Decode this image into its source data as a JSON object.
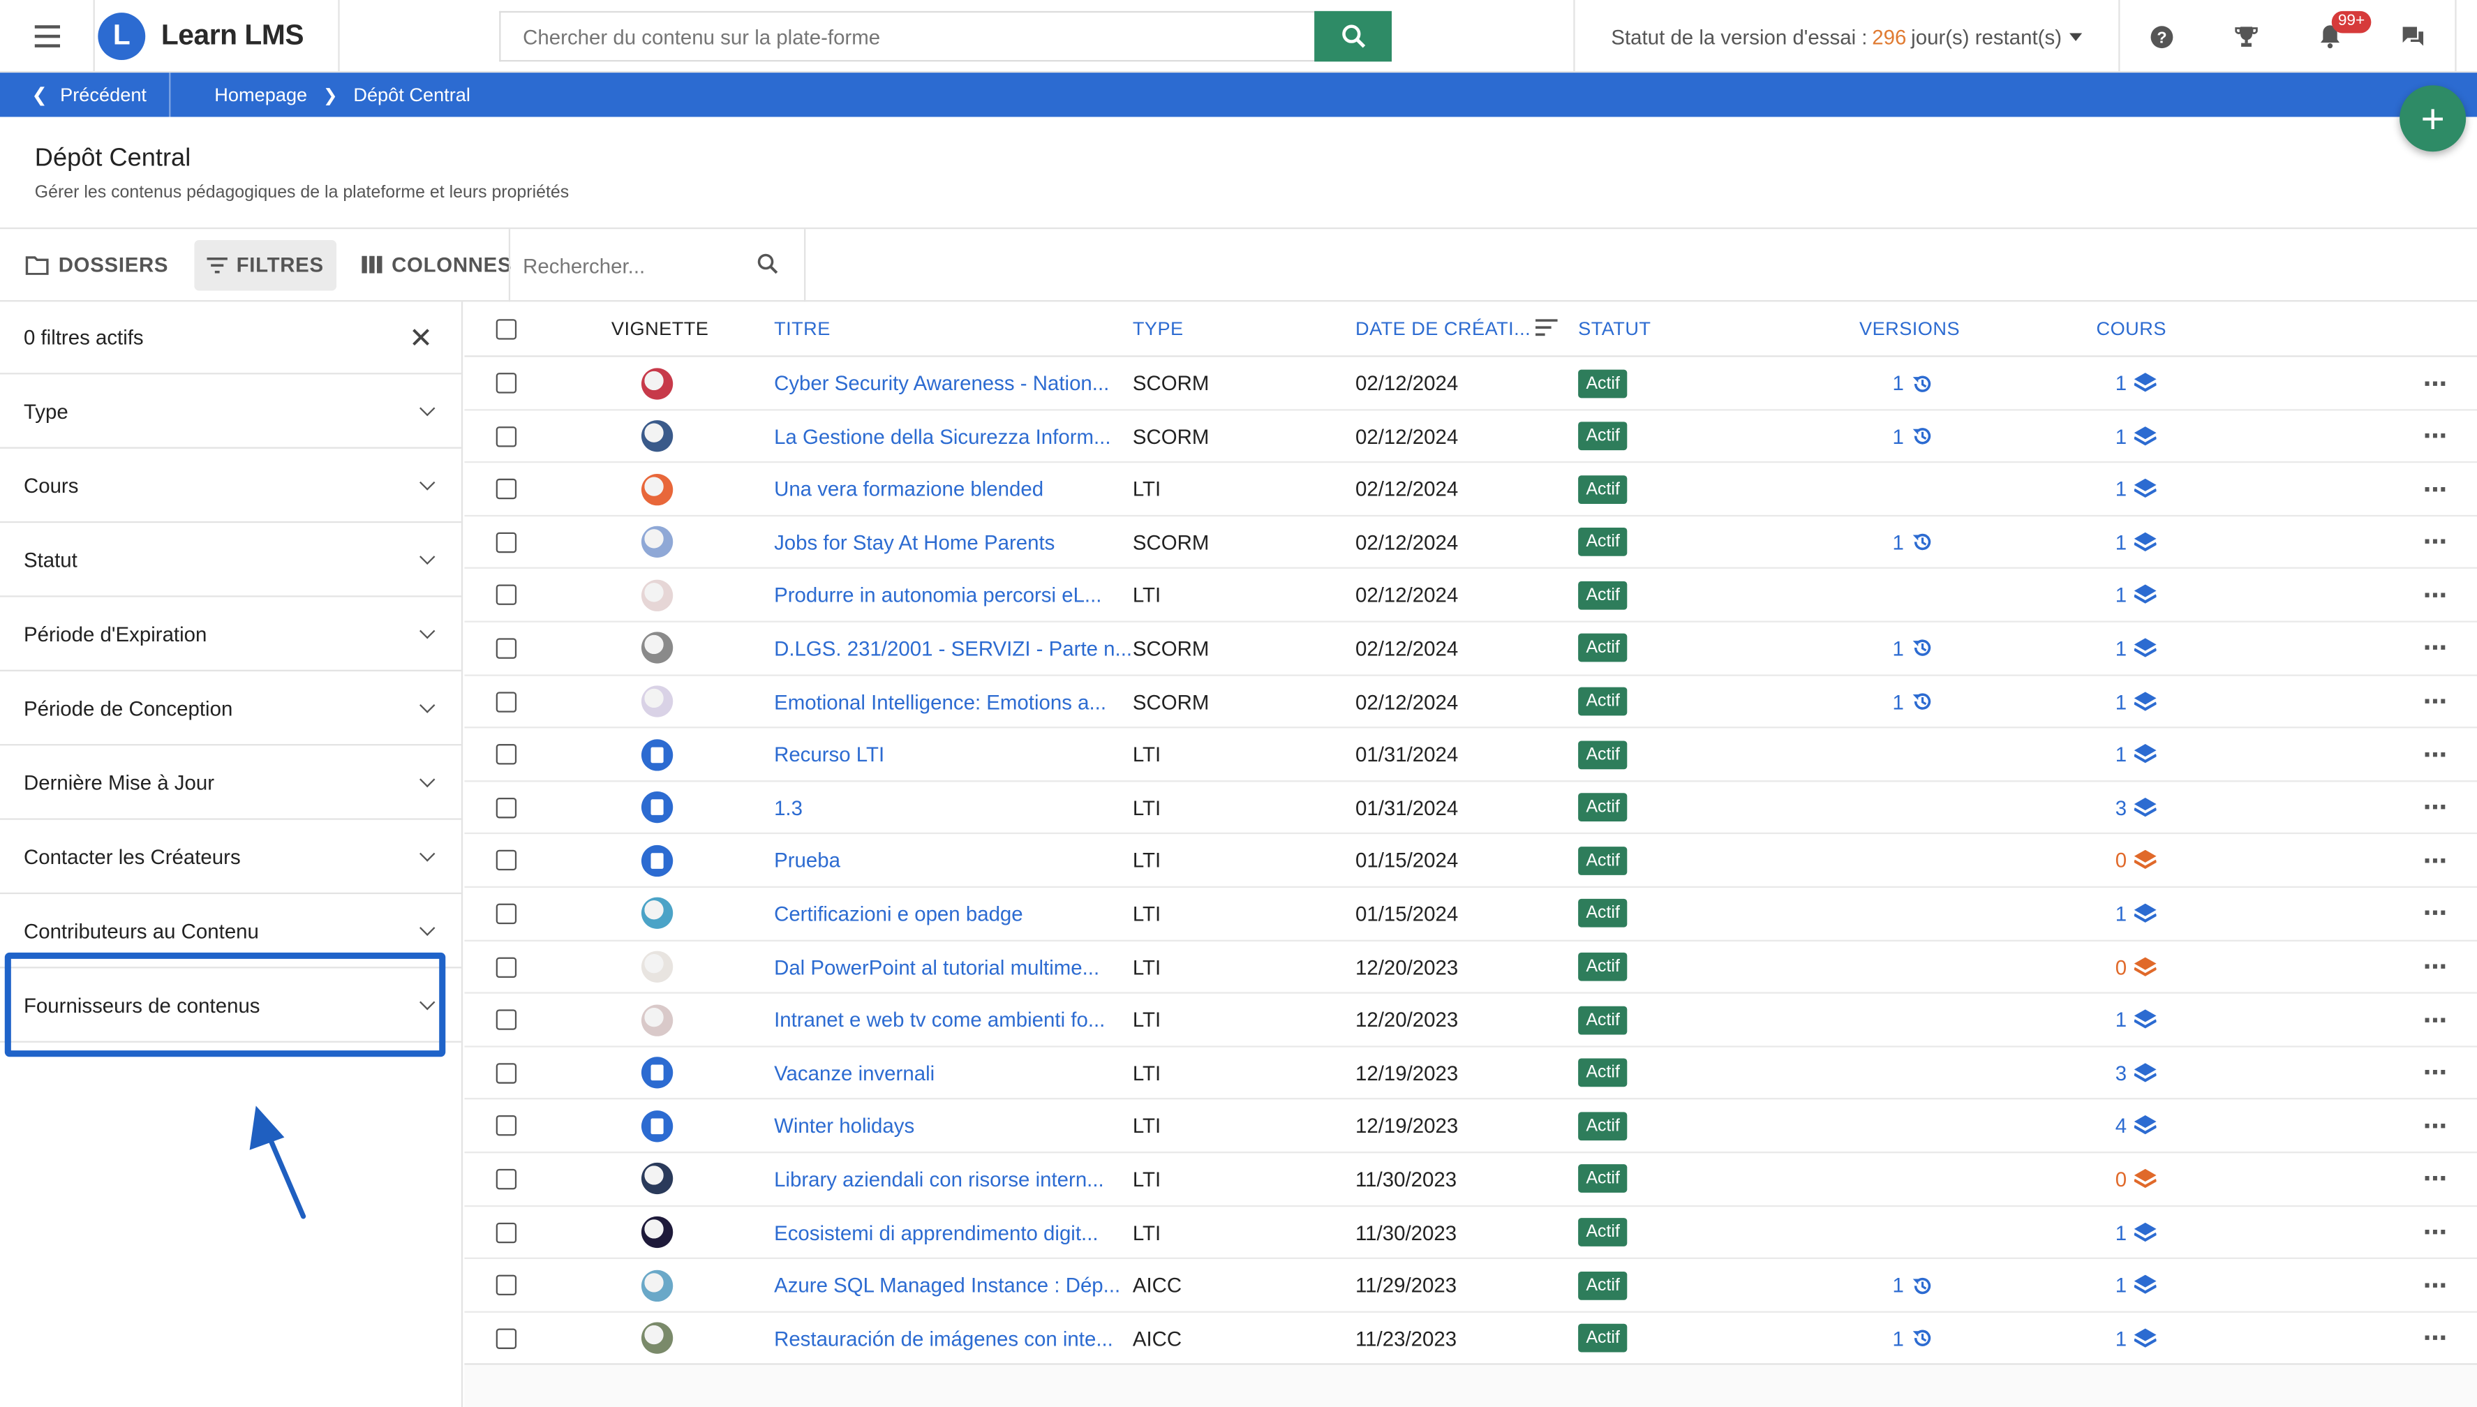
{
  "app": {
    "name": "Learn LMS",
    "logo_letter": "L"
  },
  "search": {
    "placeholder": "Chercher du contenu sur la plate-forme"
  },
  "trial": {
    "prefix": "Statut de la version d'essai :",
    "days": "296",
    "suffix": "jour(s) restant(s)"
  },
  "notifications": {
    "badge": "99+"
  },
  "breadcrumb": {
    "back": "Précédent",
    "items": [
      "Homepage",
      "Dépôt Central"
    ]
  },
  "fab": {
    "label": "+"
  },
  "page": {
    "title": "Dépôt Central",
    "subtitle": "Gérer les contenus pédagogiques de la plateforme et leurs propriétés"
  },
  "toolbar": {
    "folders": "DOSSIERS",
    "filters": "FILTRES",
    "columns": "COLONNES",
    "search_placeholder": "Rechercher..."
  },
  "sidebar": {
    "active_filters": "0 filtres actifs",
    "filters": [
      "Type",
      "Cours",
      "Statut",
      "Période d'Expiration",
      "Période de Conception",
      "Dernière Mise à Jour",
      "Contacter les Créateurs",
      "Contributeurs au Contenu",
      "Fournisseurs de contenus"
    ]
  },
  "table": {
    "columns": {
      "thumbnail": "VIGNETTE",
      "title": "TITRE",
      "type": "TYPE",
      "date": "DATE DE CRÉATI...",
      "status": "STATUT",
      "versions": "VERSIONS",
      "courses": "COURS"
    },
    "rows": [
      {
        "title": "Cyber Security Awareness - Nation...",
        "type": "SCORM",
        "date": "02/12/2024",
        "status": "Actif",
        "versions": "1",
        "courses": "1",
        "thumb": "img",
        "thumb_color": "#c73a4a"
      },
      {
        "title": "La Gestione della Sicurezza Inform...",
        "type": "SCORM",
        "date": "02/12/2024",
        "status": "Actif",
        "versions": "1",
        "courses": "1",
        "thumb": "img",
        "thumb_color": "#3a5a8a"
      },
      {
        "title": "Una vera formazione blended",
        "type": "LTI",
        "date": "02/12/2024",
        "status": "Actif",
        "versions": "",
        "courses": "1",
        "thumb": "img",
        "thumb_color": "#e8673a"
      },
      {
        "title": "Jobs for Stay At Home Parents",
        "type": "SCORM",
        "date": "02/12/2024",
        "status": "Actif",
        "versions": "1",
        "courses": "1",
        "thumb": "img",
        "thumb_color": "#8fa8d6"
      },
      {
        "title": "Produrre in autonomia percorsi eL...",
        "type": "LTI",
        "date": "02/12/2024",
        "status": "Actif",
        "versions": "",
        "courses": "1",
        "thumb": "img",
        "thumb_color": "#e6d6d6"
      },
      {
        "title": "D.LGS. 231/2001 - SERVIZI - Parte n...",
        "type": "SCORM",
        "date": "02/12/2024",
        "status": "Actif",
        "versions": "1",
        "courses": "1",
        "thumb": "img",
        "thumb_color": "#8a8a8a"
      },
      {
        "title": "Emotional Intelligence: Emotions a...",
        "type": "SCORM",
        "date": "02/12/2024",
        "status": "Actif",
        "versions": "1",
        "courses": "1",
        "thumb": "img",
        "thumb_color": "#d9d2e6"
      },
      {
        "title": "Recurso LTI",
        "type": "LTI",
        "date": "01/31/2024",
        "status": "Actif",
        "versions": "",
        "courses": "1",
        "thumb": "doc",
        "thumb_color": "#2c6bd1"
      },
      {
        "title": "1.3",
        "type": "LTI",
        "date": "01/31/2024",
        "status": "Actif",
        "versions": "",
        "courses": "3",
        "thumb": "doc",
        "thumb_color": "#2c6bd1"
      },
      {
        "title": "Prueba",
        "type": "LTI",
        "date": "01/15/2024",
        "status": "Actif",
        "versions": "",
        "courses": "0",
        "thumb": "doc",
        "thumb_color": "#2c6bd1"
      },
      {
        "title": "Certificazioni e open badge",
        "type": "LTI",
        "date": "01/15/2024",
        "status": "Actif",
        "versions": "",
        "courses": "1",
        "thumb": "img",
        "thumb_color": "#4ba3c7"
      },
      {
        "title": "Dal PowerPoint al tutorial multime...",
        "type": "LTI",
        "date": "12/20/2023",
        "status": "Actif",
        "versions": "",
        "courses": "0",
        "thumb": "img",
        "thumb_color": "#e8e4e0"
      },
      {
        "title": "Intranet e web tv come ambienti fo...",
        "type": "LTI",
        "date": "12/20/2023",
        "status": "Actif",
        "versions": "",
        "courses": "1",
        "thumb": "img",
        "thumb_color": "#d9c9c9"
      },
      {
        "title": "Vacanze invernali",
        "type": "LTI",
        "date": "12/19/2023",
        "status": "Actif",
        "versions": "",
        "courses": "3",
        "thumb": "doc",
        "thumb_color": "#2c6bd1"
      },
      {
        "title": "Winter holidays",
        "type": "LTI",
        "date": "12/19/2023",
        "status": "Actif",
        "versions": "",
        "courses": "4",
        "thumb": "doc",
        "thumb_color": "#2c6bd1"
      },
      {
        "title": "Library aziendali con risorse intern...",
        "type": "LTI",
        "date": "11/30/2023",
        "status": "Actif",
        "versions": "",
        "courses": "0",
        "thumb": "img",
        "thumb_color": "#2a3a5a"
      },
      {
        "title": "Ecosistemi di apprendimento digit...",
        "type": "LTI",
        "date": "11/30/2023",
        "status": "Actif",
        "versions": "",
        "courses": "1",
        "thumb": "img",
        "thumb_color": "#1e1a3a"
      },
      {
        "title": "Azure SQL Managed Instance : Dép...",
        "type": "AICC",
        "date": "11/29/2023",
        "status": "Actif",
        "versions": "1",
        "courses": "1",
        "thumb": "img",
        "thumb_color": "#6aa8c8"
      },
      {
        "title": "Restauración de imágenes con inte...",
        "type": "AICC",
        "date": "11/23/2023",
        "status": "Actif",
        "versions": "1",
        "courses": "1",
        "thumb": "img",
        "thumb_color": "#7a8a6a"
      }
    ]
  },
  "colors": {
    "primary": "#2c6bd1",
    "accent_green": "#2e8b66",
    "status_green": "#2e7d5b",
    "zero_orange": "#e0692a",
    "highlight": "#1f63c9"
  },
  "icons": [
    "menu-icon",
    "search-icon",
    "help-icon",
    "trophy-icon",
    "bell-icon",
    "chat-icon",
    "gear-icon",
    "folder-icon",
    "filter-icon",
    "columns-icon",
    "close-icon",
    "chevron-down-icon",
    "history-icon",
    "layers-icon",
    "more-icon",
    "arrow-icon"
  ]
}
